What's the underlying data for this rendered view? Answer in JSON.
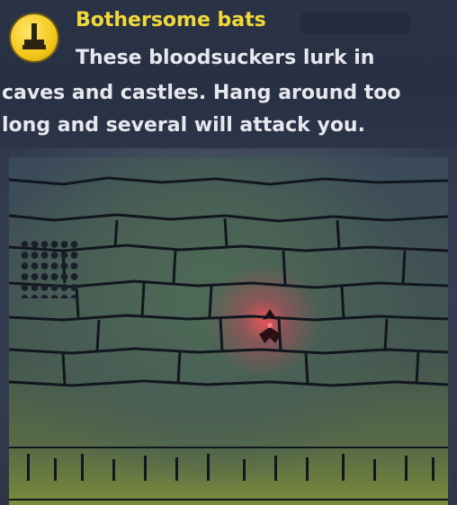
{
  "tip": {
    "icon": "joystick-icon",
    "title": "Bothersome bats",
    "lines": [
      "These bloodsuckers lurk in",
      "caves and castles. Hang around too",
      "long and several will attack you."
    ]
  },
  "scene": {
    "enemy": "bat-sprite",
    "colors": {
      "accent": "#f1d83a",
      "text": "#e6e8ee",
      "glow": "#ff5060"
    }
  }
}
